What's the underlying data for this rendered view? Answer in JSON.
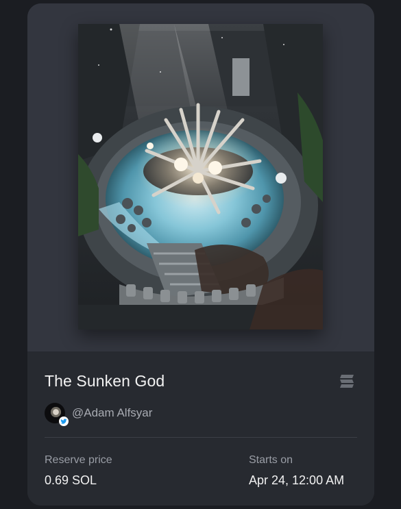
{
  "artwork": {
    "title": "The Sunken God",
    "creator": "@Adam Alfsyar"
  },
  "auction": {
    "reserve_label": "Reserve price",
    "reserve_value": "0.69 SOL",
    "starts_label": "Starts on",
    "starts_value": "Apr 24, 12:00 AM"
  },
  "icons": {
    "menu": "stack-icon",
    "verified": "twitter-verified-icon"
  },
  "colors": {
    "page_bg": "#1b1d22",
    "card_top": "#33363f",
    "card_bottom": "#272a30",
    "text_primary": "#f2f2f2",
    "text_secondary": "#9a9ea6",
    "water": "#7fc3d9"
  }
}
